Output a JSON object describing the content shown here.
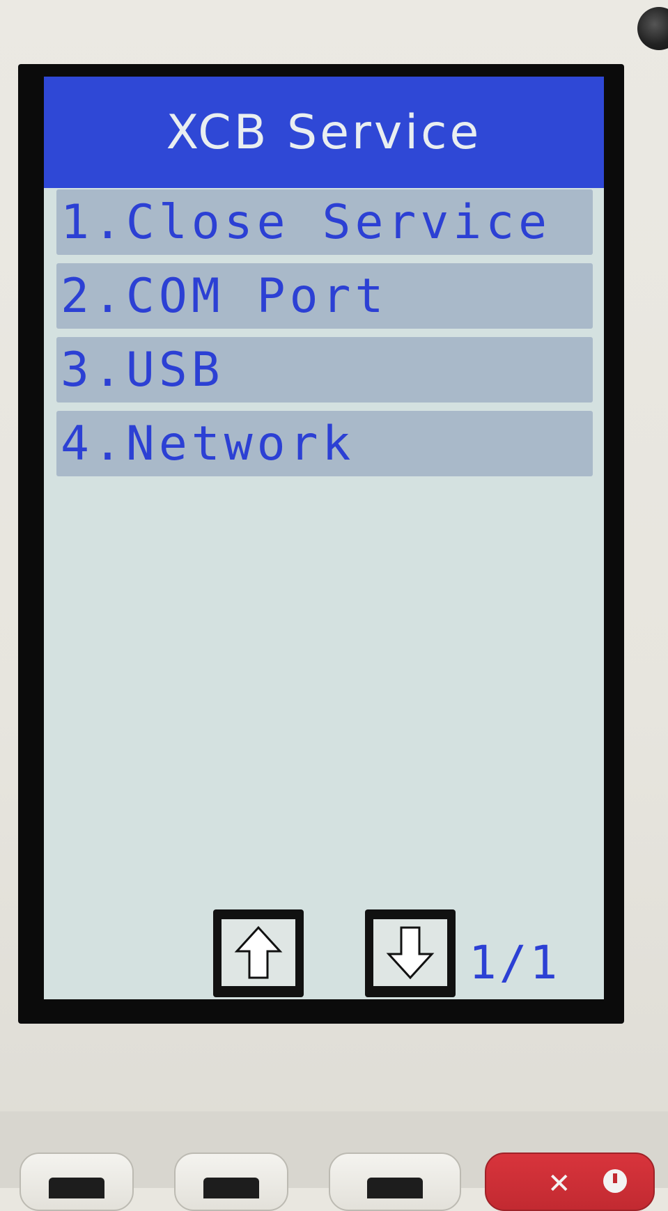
{
  "screen": {
    "title": "XCB Service",
    "menu_items": [
      {
        "label": "1.Close Service"
      },
      {
        "label": "2.COM Port"
      },
      {
        "label": "3.USB"
      },
      {
        "label": "4.Network"
      }
    ],
    "page_indicator": "1/1",
    "nav": {
      "up_icon": "up-arrow-icon",
      "down_icon": "down-arrow-icon"
    }
  },
  "colors": {
    "title_bar": "#2f48d6",
    "menu_text": "#2c40d4",
    "menu_item_bg": "#a9b9c9",
    "screen_bg": "#d4e1e0",
    "cancel_key": "#c22a31"
  }
}
